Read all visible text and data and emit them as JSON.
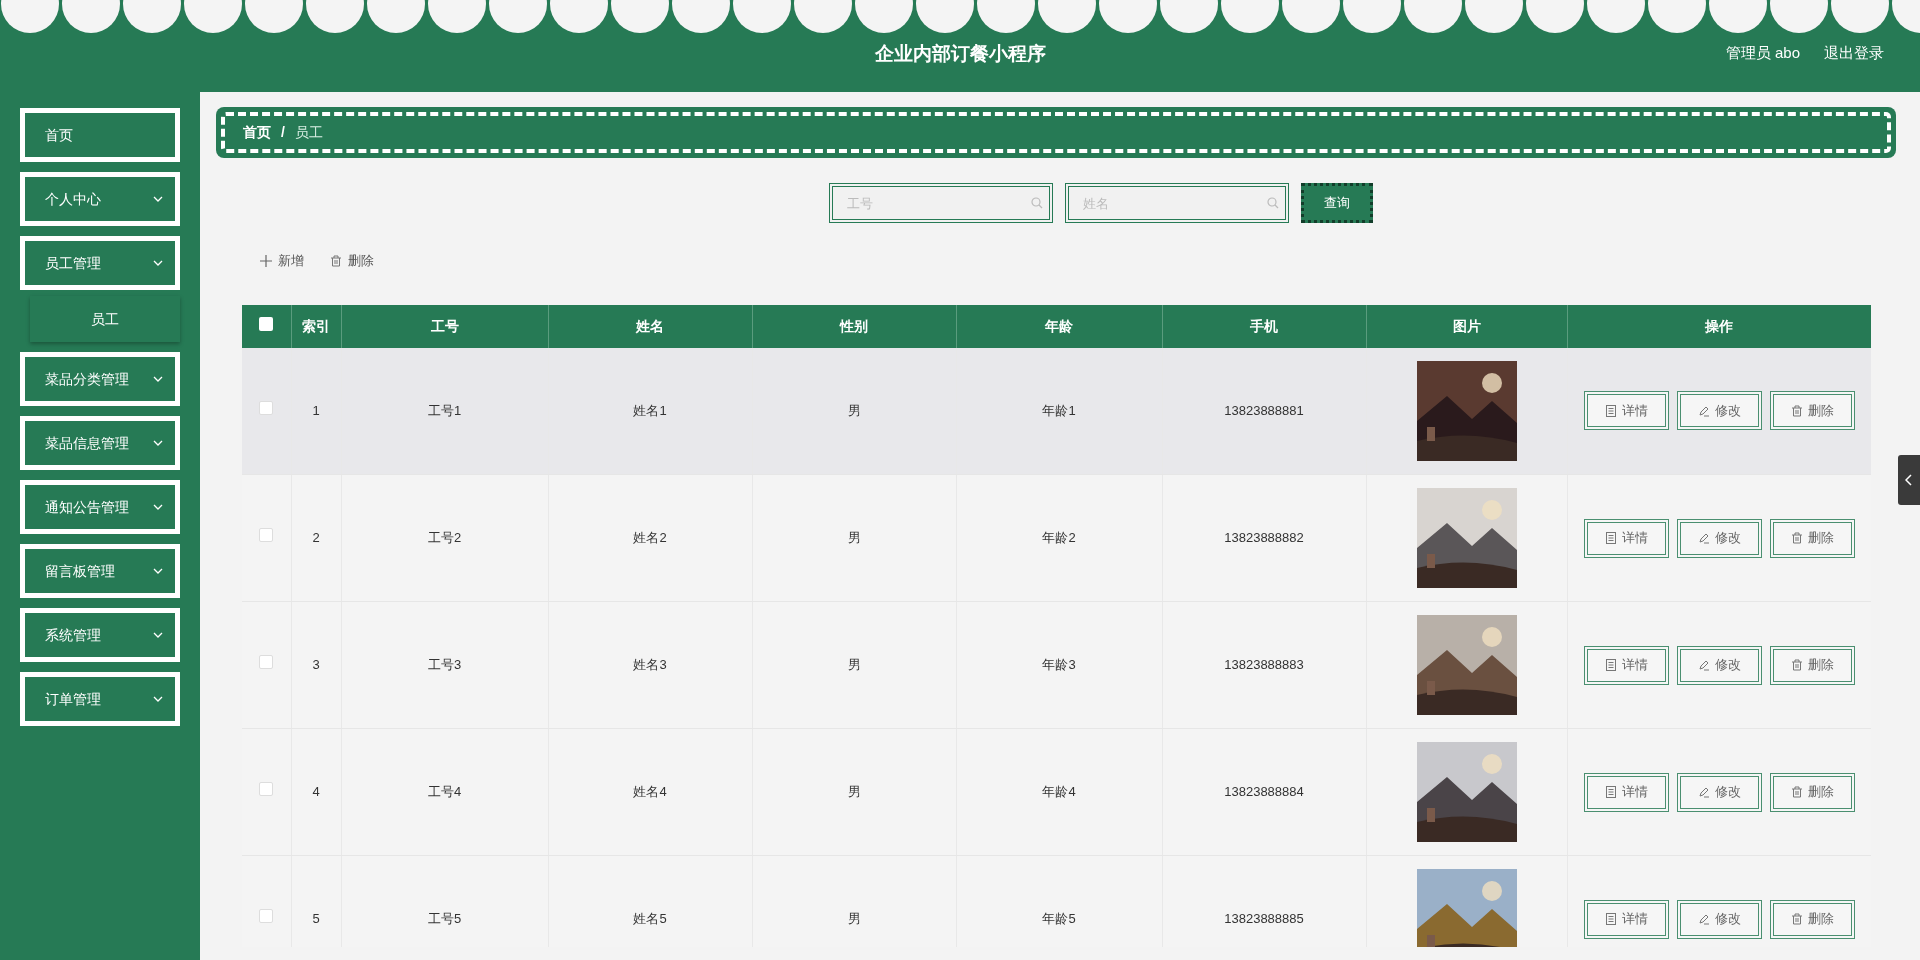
{
  "header": {
    "title": "企业内部订餐小程序",
    "user": "管理员 abo",
    "logout": "退出登录"
  },
  "sidebar": {
    "items": [
      {
        "label": "首页",
        "kind": "link"
      },
      {
        "label": "个人中心",
        "kind": "menu"
      },
      {
        "label": "员工管理",
        "kind": "menu",
        "children": [
          {
            "label": "员工"
          }
        ]
      },
      {
        "label": "菜品分类管理",
        "kind": "menu"
      },
      {
        "label": "菜品信息管理",
        "kind": "menu"
      },
      {
        "label": "通知公告管理",
        "kind": "menu"
      },
      {
        "label": "留言板管理",
        "kind": "menu"
      },
      {
        "label": "系统管理",
        "kind": "menu"
      },
      {
        "label": "订单管理",
        "kind": "menu"
      }
    ]
  },
  "breadcrumb": {
    "items": [
      {
        "label": "首页",
        "current": false
      },
      {
        "label": "员工",
        "current": true
      }
    ],
    "separator": "/"
  },
  "search": {
    "fields": [
      {
        "placeholder": "工号"
      },
      {
        "placeholder": "姓名"
      }
    ],
    "button": "查询"
  },
  "toolbar": [
    {
      "kind": "add",
      "label": "新增"
    },
    {
      "kind": "delete",
      "label": "删除"
    }
  ],
  "table": {
    "header_checked": false,
    "columns": [
      "索引",
      "工号",
      "姓名",
      "性别",
      "年龄",
      "手机",
      "图片",
      "操作"
    ],
    "rows": [
      {
        "checked": false,
        "hovered": true,
        "cells": [
          "1",
          "工号1",
          "姓名1",
          "男",
          "年龄1",
          "13823888881"
        ],
        "actions": [
          {
            "kind": "detail",
            "label": "详情"
          },
          {
            "kind": "edit",
            "label": "修改"
          },
          {
            "kind": "delete",
            "label": "删除"
          }
        ]
      },
      {
        "checked": false,
        "hovered": false,
        "cells": [
          "2",
          "工号2",
          "姓名2",
          "男",
          "年龄2",
          "13823888882"
        ],
        "actions": [
          {
            "kind": "detail",
            "label": "详情"
          },
          {
            "kind": "edit",
            "label": "修改"
          },
          {
            "kind": "delete",
            "label": "删除"
          }
        ]
      },
      {
        "checked": false,
        "hovered": false,
        "cells": [
          "3",
          "工号3",
          "姓名3",
          "男",
          "年龄3",
          "13823888883"
        ],
        "actions": [
          {
            "kind": "detail",
            "label": "详情"
          },
          {
            "kind": "edit",
            "label": "修改"
          },
          {
            "kind": "delete",
            "label": "删除"
          }
        ]
      },
      {
        "checked": false,
        "hovered": false,
        "cells": [
          "4",
          "工号4",
          "姓名4",
          "男",
          "年龄4",
          "13823888884"
        ],
        "actions": [
          {
            "kind": "detail",
            "label": "详情"
          },
          {
            "kind": "edit",
            "label": "修改"
          },
          {
            "kind": "delete",
            "label": "删除"
          }
        ]
      },
      {
        "checked": false,
        "hovered": false,
        "cells": [
          "5",
          "工号5",
          "姓名5",
          "男",
          "年龄5",
          "13823888885"
        ],
        "actions": [
          {
            "kind": "detail",
            "label": "详情"
          },
          {
            "kind": "edit",
            "label": "修改"
          },
          {
            "kind": "delete",
            "label": "删除"
          }
        ]
      }
    ]
  }
}
